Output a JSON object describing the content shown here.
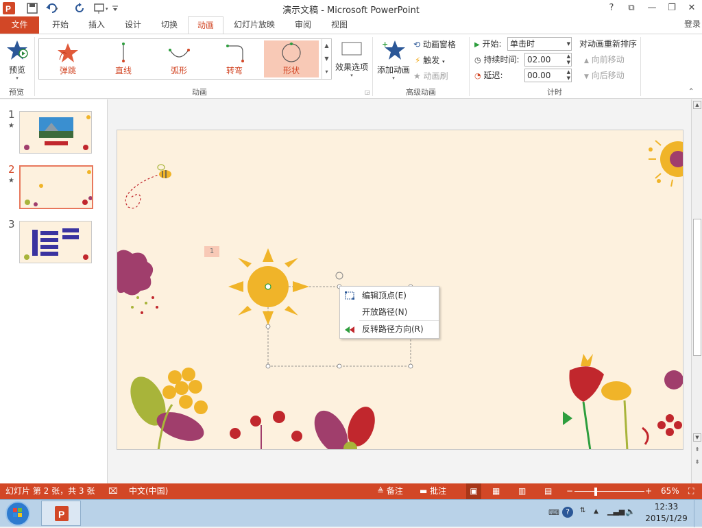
{
  "window": {
    "title": "演示文稿 - Microsoft PowerPoint",
    "controls": [
      "?",
      "⧉",
      "—",
      "❐",
      "✕"
    ],
    "login": "登录"
  },
  "tabs": [
    {
      "label": "文件"
    },
    {
      "label": "开始"
    },
    {
      "label": "插入"
    },
    {
      "label": "设计"
    },
    {
      "label": "切换"
    },
    {
      "label": "动画"
    },
    {
      "label": "幻灯片放映"
    },
    {
      "label": "审阅"
    },
    {
      "label": "视图"
    }
  ],
  "ribbon": {
    "preview": {
      "label": "预览",
      "group": "预览"
    },
    "gallery": {
      "group": "动画",
      "items": [
        {
          "label": "弹跳"
        },
        {
          "label": "直线"
        },
        {
          "label": "弧形"
        },
        {
          "label": "转弯"
        },
        {
          "label": "形状"
        }
      ]
    },
    "effect_options": "效果选项",
    "advanced": {
      "group": "高级动画",
      "add_animation": "添加动画",
      "animation_pane": "动画窗格",
      "trigger": "触发",
      "animation_painter": "动画刷"
    },
    "timing": {
      "group": "计时",
      "start_label": "开始:",
      "start_value": "单击时",
      "duration_label": "持续时间:",
      "duration_value": "02.00",
      "delay_label": "延迟:",
      "delay_value": "00.00"
    },
    "reorder": {
      "title": "对动画重新排序",
      "move_earlier": "向前移动",
      "move_later": "向后移动"
    }
  },
  "thumbnails": [
    {
      "num": "1",
      "star": "★"
    },
    {
      "num": "2",
      "star": "★"
    },
    {
      "num": "3",
      "star": ""
    }
  ],
  "slide": {
    "animation_badge": "1"
  },
  "context_menu": [
    {
      "label": "编辑顶点(E)",
      "icon": "edit-points-icon"
    },
    {
      "label": "开放路径(N)",
      "icon": ""
    },
    {
      "label": "反转路径方向(R)",
      "icon": "reverse-path-icon"
    }
  ],
  "status": {
    "slide_info": "幻灯片 第 2 张，共 3 张",
    "language": "中文(中国)",
    "notes": "备注",
    "comments": "批注",
    "zoom": "65%"
  },
  "taskbar": {
    "time": "12:33",
    "date": "2015/1/29"
  }
}
